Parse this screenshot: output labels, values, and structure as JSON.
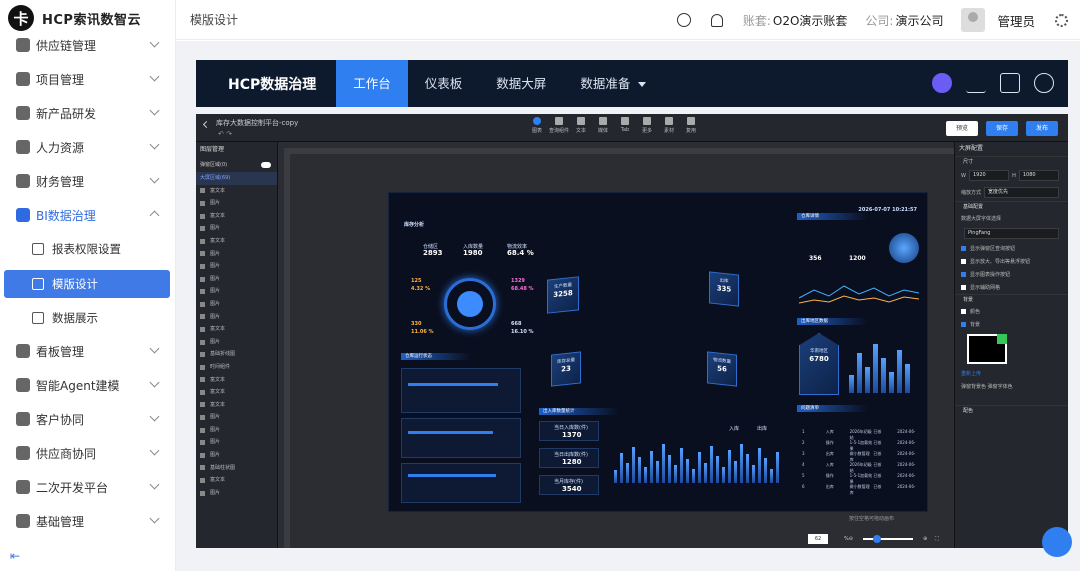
{
  "brand": {
    "name": "HCP索讯数智云",
    "logo_char": "卡"
  },
  "sidebar": {
    "items": [
      {
        "label": "供应链管理"
      },
      {
        "label": "项目管理"
      },
      {
        "label": "新产品研发"
      },
      {
        "label": "人力资源"
      },
      {
        "label": "财务管理"
      },
      {
        "label": "BI数据治理",
        "expanded": true
      },
      {
        "label": "看板管理"
      },
      {
        "label": "智能Agent建模"
      },
      {
        "label": "客户协同"
      },
      {
        "label": "供应商协同"
      },
      {
        "label": "二次开发平台"
      },
      {
        "label": "基础管理"
      }
    ],
    "sub_items": [
      {
        "label": "报表权限设置"
      },
      {
        "label": "模版设计",
        "active": true
      },
      {
        "label": "数据展示"
      }
    ],
    "collapse_icon": "collapse-icon"
  },
  "header": {
    "crumb": "模版设计",
    "account_label": "账套:",
    "account_value": "O2O演示账套",
    "company_label": "公司:",
    "company_value": "演示公司",
    "user": "管理员"
  },
  "topnav": {
    "brand": "HCP数据治理",
    "tabs": [
      "工作台",
      "仪表板",
      "数据大屏",
      "数据准备"
    ],
    "active_tab": 0
  },
  "editor": {
    "title": "库存大数据控制平台-copy",
    "tools": [
      "图表",
      "查询组件",
      "文本",
      "媒体",
      "Tab",
      "更多",
      "素材",
      "复用"
    ],
    "preview": "预览",
    "save": "保存",
    "publish": "发布",
    "layers_title": "图层管理",
    "layers_group": "弹窗区域(0)",
    "layers_root": "大屏区域(69)",
    "layers": [
      "富文本",
      "图片",
      "富文本",
      "图片",
      "富文本",
      "图片",
      "图片",
      "图片",
      "图片",
      "图片",
      "图片",
      "富文本",
      "图片",
      "基础折线图",
      "时间组件",
      "富文本",
      "富文本",
      "富文本",
      "图片",
      "图片",
      "图片",
      "图片",
      "基础柱状图",
      "富文本",
      "图片"
    ],
    "hint": "按住空格可拖动画布",
    "zoom": "62",
    "zoom_unit": "%",
    "props": {
      "title": "大屏配置",
      "size": "尺寸",
      "w_label": "W",
      "w": "1920",
      "h_label": "H",
      "h": "1080",
      "scale_label": "缩放方式",
      "scale": "宽度优先",
      "basic": "基础配置",
      "font_label": "数据大屏字体选择",
      "font": "PingFang",
      "opts": [
        "显示弹窗区查询按钮",
        "显示放大、导出等悬浮按钮",
        "显示图表操作按钮",
        "显示辅助网格"
      ],
      "bg": "背景",
      "bg_color": "颜色",
      "bg_image": "背景",
      "reupload": "重新上传",
      "popup_bg": "弹窗背景色",
      "popup_font": "弹窗字体色",
      "palette": "配色"
    }
  },
  "dashboard": {
    "datetime": "2026-07-07 10:21:57",
    "left_title": "库存分析",
    "stats": [
      {
        "label": "仓储区",
        "value": "2893"
      },
      {
        "label": "入库数量",
        "value": "1980"
      },
      {
        "label": "物流效率",
        "value": "68.4 %"
      }
    ],
    "ring_values": [
      {
        "a": "125",
        "b": "4.32 %"
      },
      {
        "a": "1329",
        "b": "68.48 %"
      },
      {
        "a": "330",
        "b": "11.06 %"
      },
      {
        "a": "668",
        "b": "16.10 %"
      }
    ],
    "cards": [
      {
        "label": "生产数量",
        "value": "3258"
      },
      {
        "label": "出库",
        "value": "335"
      },
      {
        "label": "库存总量",
        "value": "23"
      },
      {
        "label": "物流数量",
        "value": "56"
      }
    ],
    "warehouse_title": "仓库运行状态",
    "center_title": "出入库数量统计",
    "center_kpis": [
      {
        "label": "当日入库数(件)",
        "value": "1370"
      },
      {
        "label": "当日出库数(件)",
        "value": "1280"
      },
      {
        "label": "当月库存(件)",
        "value": "3540"
      }
    ],
    "legend": [
      "入库",
      "出库"
    ],
    "right_title": "仓库详情",
    "r_values": [
      "356",
      "1200"
    ],
    "region_title": "出库地区数据",
    "region_label": "华南地区",
    "region_value": "6780",
    "issues_title": "问题清单",
    "issue_rows": [
      [
        "1",
        "入库",
        "2026年初级结",
        "已核",
        "2024-06-"
      ],
      [
        "2",
        "操作",
        "1-5-1加载效果",
        "已核",
        "2024-06-"
      ],
      [
        "3",
        "出库",
        "做小数管理库",
        "已核",
        "2024-06-"
      ],
      [
        "4",
        "入库",
        "2026年初级结",
        "已核",
        "2024-06-"
      ],
      [
        "5",
        "操作",
        "1-5-1加载效果",
        "已核",
        "2024-06-"
      ],
      [
        "6",
        "出库",
        "做小数管理库",
        "已核",
        "2024-06-"
      ]
    ]
  }
}
